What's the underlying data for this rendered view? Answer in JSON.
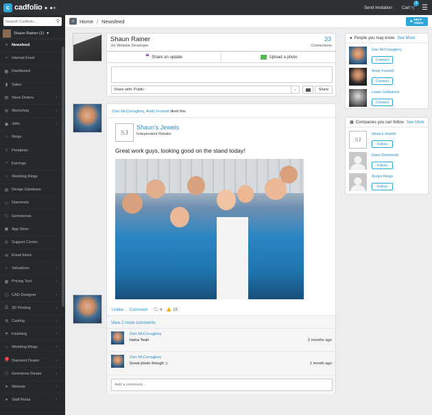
{
  "app": {
    "logo_text": "cadfolio",
    "send_invitation": "Send Invitation",
    "cart_label": "Cart",
    "cart_count": "4",
    "help_video": "HELP\nVIDEO"
  },
  "sidebar": {
    "search_placeholder": "Search Cadfolio...",
    "user_name": "Shaun Rainer (1)",
    "items": [
      {
        "label": "Newsfeed",
        "icon": "rss-icon",
        "active": true
      },
      {
        "label": "Internal Feed",
        "icon": "rss-icon"
      },
      {
        "label": "Dashboard",
        "icon": "dashboard-icon"
      },
      {
        "label": "Sales",
        "icon": "chart-icon"
      },
      {
        "label": "Store Orders",
        "icon": "cart-icon",
        "chevron": true
      },
      {
        "label": "Workshop",
        "icon": "wrench-icon",
        "chevron": true
      },
      {
        "label": "Jobs",
        "icon": "briefcase-icon",
        "chevron": true
      },
      {
        "label": "Rings",
        "icon": "ring-icon"
      },
      {
        "label": "Pendents",
        "icon": "pendant-icon"
      },
      {
        "label": "Earrings",
        "icon": "earring-icon"
      },
      {
        "label": "Wedding Rings",
        "icon": "ring-icon"
      },
      {
        "label": "Design Database",
        "icon": "database-icon"
      },
      {
        "label": "Diamonds",
        "icon": "diamond-icon"
      },
      {
        "label": "Gemstones",
        "icon": "gem-icon"
      },
      {
        "label": "App Store",
        "icon": "apps-icon"
      },
      {
        "label": "Support Centre",
        "icon": "support-icon"
      },
      {
        "label": "Email Inbox",
        "icon": "mail-icon"
      },
      {
        "label": "Valuations",
        "icon": "tag-icon",
        "chevron": true
      },
      {
        "label": "Pricing Tool",
        "icon": "calculator-icon",
        "chevron": true
      },
      {
        "label": "CAD Designer",
        "icon": "cad-icon",
        "chevron": true
      },
      {
        "label": "3D Printing",
        "icon": "printer-icon",
        "chevron": true
      },
      {
        "label": "Casting",
        "icon": "flask-icon",
        "chevron": true
      },
      {
        "label": "Finishing",
        "icon": "filter-icon",
        "chevron": true
      },
      {
        "label": "Wedding Rings",
        "icon": "ring-icon",
        "chevron": true
      },
      {
        "label": "Diamond Dealer",
        "icon": "diamond-icon",
        "chevron": true,
        "badge": "1"
      },
      {
        "label": "Gemstone Dealer",
        "icon": "gem-icon",
        "chevron": true
      },
      {
        "label": "Website",
        "icon": "globe-icon",
        "chevron": true
      },
      {
        "label": "Staff Rotas",
        "icon": "users-icon",
        "chevron": true
      }
    ]
  },
  "breadcrumb": {
    "home": "Home",
    "current": "Newsfeed"
  },
  "profile": {
    "name": "Shaun Rainer",
    "role": "Jnr Website Developer",
    "connections_count": "33",
    "connections_label": "Connections",
    "share_update": "Share an update",
    "upload_photo": "Upload a photo",
    "share_with": "Share with: Public",
    "share_button": "Share"
  },
  "post": {
    "liker1": "Dan McConaghey",
    "liker_sep": ", ",
    "liker2": "Andy Fossett",
    "liked_text": " liked this",
    "company_logo": "SJ",
    "company_name": "Shaun's Jewels",
    "company_type": "Independent Retailer",
    "text": "Great work guys, looking good on the stand today!",
    "unlike": "Unlike",
    "dot": "·",
    "comment": "Comment",
    "comment_count": "4",
    "like_count": "15",
    "view_more": "View 2 more comments",
    "comments": [
      {
        "author": "Dan McConaghey",
        "text": "Haha Yeah",
        "time": "2 months ago"
      },
      {
        "author": "Dan McConaghey",
        "text": "Great photo though :)",
        "time": "1 month ago"
      }
    ],
    "add_comment_placeholder": "Add a comment..."
  },
  "people": {
    "title": "People you may know",
    "see_more": "See More",
    "items": [
      {
        "name": "Dan McConaghey",
        "button": "Connect"
      },
      {
        "name": "Andy Fossett",
        "button": "Connect"
      },
      {
        "name": "Lewis Goldstone",
        "button": "Connect"
      }
    ]
  },
  "companies": {
    "title": "Companies you can follow",
    "see_more": "See More",
    "items": [
      {
        "name": "Ideas's Jewels",
        "button": "Follow"
      },
      {
        "name": "Dans Diamonds",
        "button": "Follow"
      },
      {
        "name": "Andys Rings",
        "button": "Follow"
      }
    ]
  }
}
